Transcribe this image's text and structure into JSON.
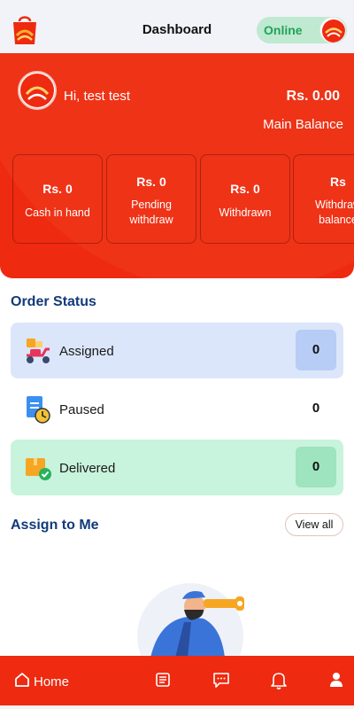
{
  "appbar": {
    "title": "Dashboard",
    "status_label": "Online"
  },
  "profile": {
    "greeting": "Hi, test test",
    "balance": "Rs. 0.00",
    "balance_label": "Main Balance"
  },
  "stats": [
    {
      "value": "Rs. 0",
      "label": "Cash in hand"
    },
    {
      "value": "Rs. 0",
      "label": "Pending withdraw"
    },
    {
      "value": "Rs. 0",
      "label": "Withdrawn"
    },
    {
      "value": "Rs",
      "label": "Withdraw balance"
    }
  ],
  "order_status": {
    "title": "Order Status",
    "items": [
      {
        "name": "Assigned",
        "count": "0",
        "icon": "delivery-scooter-icon"
      },
      {
        "name": "Paused",
        "count": "0",
        "icon": "paused-document-clock-icon"
      },
      {
        "name": "Delivered",
        "count": "0",
        "icon": "delivered-box-check-icon"
      }
    ]
  },
  "assign": {
    "title": "Assign to Me",
    "view_all": "View all"
  },
  "bottom_nav": {
    "home_label": "Home",
    "icons": [
      "home-icon",
      "orders-list-icon",
      "chat-icon",
      "notification-bell-icon",
      "profile-icon"
    ]
  },
  "colors": {
    "brand_red": "#ee2a10",
    "online_green": "#1fa35a",
    "assigned_bg": "#dbe6fb",
    "delivered_bg": "#c8f3dc",
    "title_blue": "#123a7a"
  }
}
